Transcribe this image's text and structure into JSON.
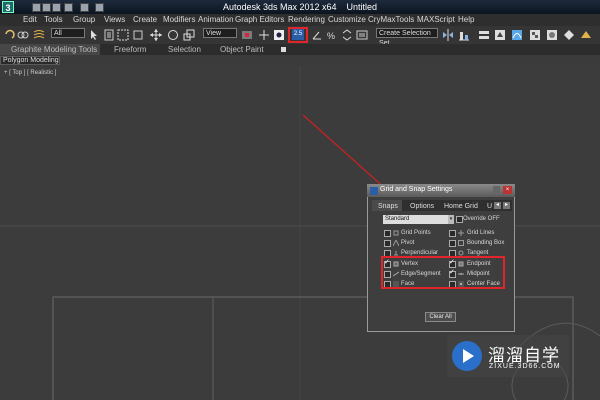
{
  "window": {
    "title": "Autodesk 3ds Max  2012 x64",
    "file": "Untitled",
    "logo": "3"
  },
  "menu": [
    "Edit",
    "Tools",
    "Group",
    "Views",
    "Create",
    "Modifiers",
    "Animation",
    "Graph Editors",
    "Rendering",
    "Customize",
    "CryMaxTools",
    "MAXScript",
    "Help"
  ],
  "toolbar": {
    "selection_filter": "All",
    "reference_coord": "View",
    "named_selection": "Create Selection Set",
    "snap_button_label": "2.5",
    "highlight_color": "#e2252b"
  },
  "ribbon": {
    "tabs": [
      "Graphite Modeling Tools",
      "Freeform",
      "Selection",
      "Object Paint"
    ],
    "panel_label": "Polygon Modeling"
  },
  "viewport": {
    "label": "+ [ Top ] [ Realistic ]"
  },
  "dialog": {
    "title": "Grid and Snap Settings",
    "tabs": [
      "Snaps",
      "Options",
      "Home Grid",
      "U"
    ],
    "preset": "Standard",
    "override_label": "Override OFF",
    "options_left": [
      "Grid Points",
      "Pivot",
      "Perpendicular",
      "Vertex",
      "Edge/Segment",
      "Face"
    ],
    "options_right": [
      "Grid Lines",
      "Bounding Box",
      "Tangent",
      "Endpoint",
      "Midpoint",
      "Center Face"
    ],
    "checked_left": [
      false,
      false,
      false,
      true,
      false,
      false
    ],
    "checked_right": [
      false,
      false,
      false,
      true,
      true,
      false
    ],
    "clear_all": "Clear All"
  },
  "watermark": {
    "name": "溜溜自学",
    "url": "ZIXUE.3D66.COM"
  }
}
